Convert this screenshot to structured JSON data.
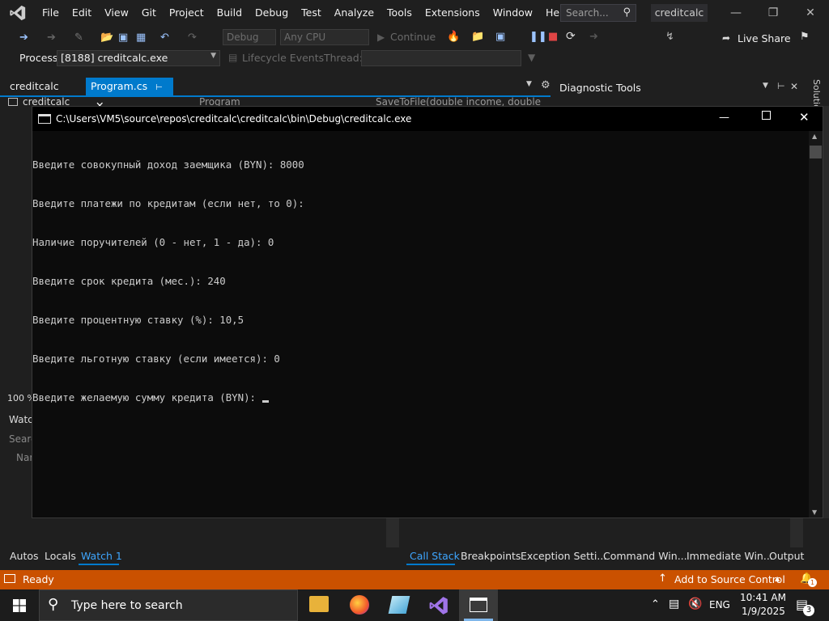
{
  "menu": {
    "items": [
      "File",
      "Edit",
      "View",
      "Git",
      "Project",
      "Build",
      "Debug",
      "Test",
      "Analyze",
      "Tools",
      "Extensions",
      "Window",
      "Help"
    ],
    "search_placeholder": "Search...",
    "solution_name": "creditcalc"
  },
  "toolbar": {
    "config": "Debug",
    "platform": "Any CPU",
    "continue_label": "Continue",
    "live_share": "Live Share"
  },
  "process_bar": {
    "process_label": "Process:",
    "process_value": "[8188] creditcalc.exe",
    "lifecycle": "Lifecycle Events",
    "thread": "Thread:"
  },
  "tabs": {
    "left_tab": "creditcalc",
    "active_tab": "Program.cs",
    "nav_left": "creditcalc",
    "nav_mid": "Program",
    "nav_right": "SaveToFile(double income, double",
    "diag_title": "Diagnostic Tools",
    "solution_side": "Solution"
  },
  "left_pane": {
    "zoom": "100 %",
    "watch_title": "Watch",
    "search": "Search",
    "name_col": "Name"
  },
  "console": {
    "title": "C:\\Users\\VM5\\source\\repos\\creditcalc\\creditcalc\\bin\\Debug\\creditcalc.exe",
    "lines": [
      "Введите совокупный доход заемщика (BYN): 8000",
      "Введите платежи по кредитам (если нет, то 0):",
      "Наличие поручителей (0 - нет, 1 - да): 0",
      "Введите срок кредита (мес.): 240",
      "Введите процентную ставку (%): 10,5",
      "Введите льготную ставку (если имеется): 0",
      "Введите желаемую сумму кредита (BYN): "
    ]
  },
  "bottom_tabs": {
    "left": [
      "Autos",
      "Locals",
      "Watch 1"
    ],
    "right": [
      "Call Stack",
      "Breakpoints",
      "Exception Setti...",
      "Command Win...",
      "Immediate Win...",
      "Output"
    ]
  },
  "status": {
    "ready": "Ready",
    "source_control": "Add to Source Control",
    "notif_count": "1"
  },
  "taskbar": {
    "search_placeholder": "Type here to search",
    "lang": "ENG",
    "time": "10:41 AM",
    "date": "1/9/2025",
    "notif_count": "3"
  },
  "colors": {
    "accent": "#007acc",
    "status_bar": "#ca5100",
    "console_bg": "#0c0c0c"
  }
}
